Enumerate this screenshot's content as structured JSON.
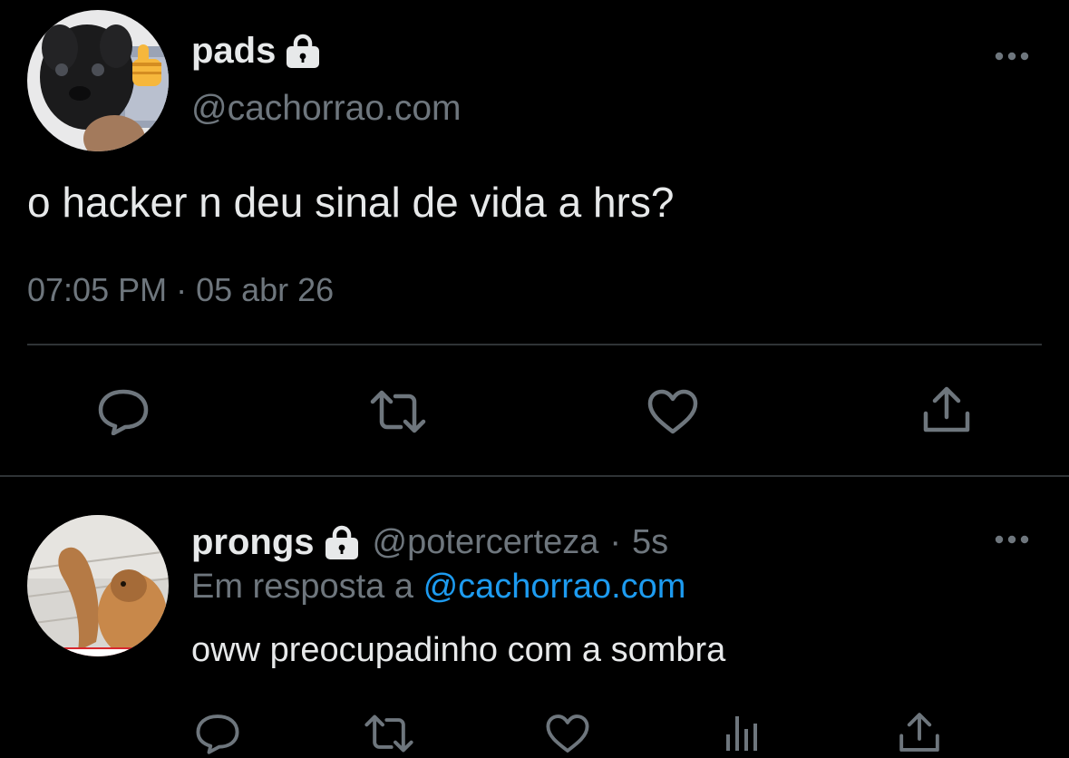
{
  "main_tweet": {
    "display_name": "pads",
    "handle": "@cachorrao.com",
    "text": "o hacker n deu sinal de vida a hrs?",
    "timestamp": "07:05 PM · 05 abr 26",
    "avatar_icon": "dog-thumbs-up-avatar",
    "actions": [
      "reply-icon",
      "retweet-icon",
      "like-icon",
      "share-icon"
    ]
  },
  "reply_tweet": {
    "display_name": "prongs",
    "handle": "@potercerteza",
    "separator": "·",
    "age": "5s",
    "reply_prefix": "Em resposta a",
    "reply_mention": "@cachorrao.com",
    "text": "oww preocupadinho com a sombra",
    "avatar_icon": "deer-avatar",
    "actions": [
      "reply-icon",
      "retweet-icon",
      "like-icon",
      "analytics-icon",
      "share-icon"
    ]
  },
  "colors": {
    "background": "#000000",
    "text_primary": "#e7e9ea",
    "text_secondary": "#6e767d",
    "accent": "#1d9bf0",
    "divider": "#2f3336"
  }
}
